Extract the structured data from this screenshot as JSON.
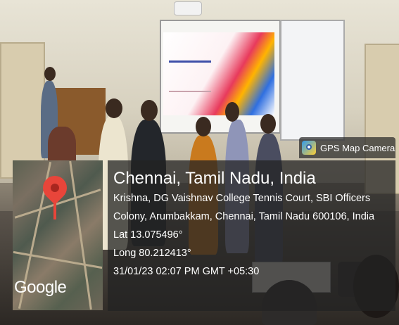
{
  "gps_badge": {
    "title": "GPS Map Camera",
    "icon": "camera-pin-icon"
  },
  "location": {
    "city": "Chennai, Tamil Nadu, India",
    "address_line_1": "Krishna, DG Vaishnav College Tennis Court, SBI Officers",
    "address_line_2": "Colony, Arumbakkam, Chennai, Tamil Nadu 600106, India",
    "latitude": "Lat 13.075496°",
    "longitude": "Long 80.212413°",
    "timestamp": "31/01/23 02:07 PM GMT +05:30"
  },
  "map": {
    "attribution": "Google",
    "pin_color": "#e8453a"
  }
}
